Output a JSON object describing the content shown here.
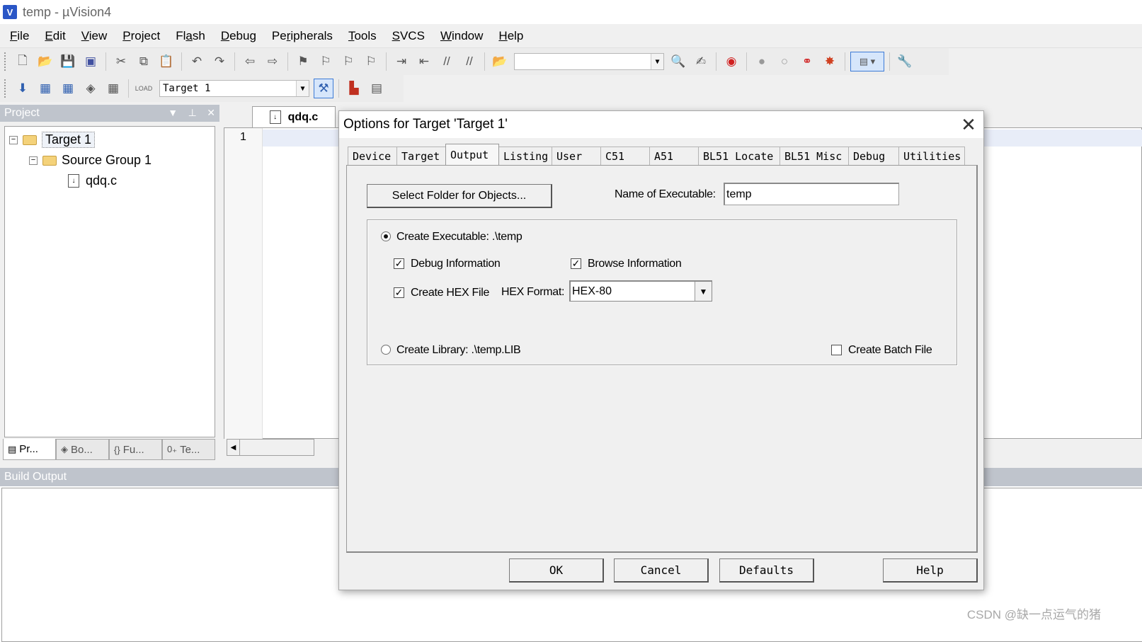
{
  "window": {
    "title": "temp  - µVision4",
    "logo": "V"
  },
  "menu": [
    {
      "pre": "",
      "u": "F",
      "post": "ile"
    },
    {
      "pre": "",
      "u": "E",
      "post": "dit"
    },
    {
      "pre": "",
      "u": "V",
      "post": "iew"
    },
    {
      "pre": "",
      "u": "P",
      "post": "roject"
    },
    {
      "pre": "Fl",
      "u": "a",
      "post": "sh"
    },
    {
      "pre": "",
      "u": "D",
      "post": "ebug"
    },
    {
      "pre": "Pe",
      "u": "r",
      "post": "ipherals"
    },
    {
      "pre": "",
      "u": "T",
      "post": "ools"
    },
    {
      "pre": "",
      "u": "S",
      "post": "VCS"
    },
    {
      "pre": "",
      "u": "W",
      "post": "indow"
    },
    {
      "pre": "",
      "u": "H",
      "post": "elp"
    }
  ],
  "toolbar2": {
    "target_combo": "Target 1",
    "load_label": "LOAD"
  },
  "project": {
    "header": "Project",
    "tree": {
      "target": "Target 1",
      "group": "Source Group 1",
      "file": "qdq.c"
    },
    "tabs": [
      "Pr...",
      "Bo...",
      "Fu...",
      "Te..."
    ],
    "tab_icons": [
      "▤",
      "◈",
      "{}",
      "0₊"
    ]
  },
  "editor": {
    "tab": "qdq.c",
    "line": "1"
  },
  "build": {
    "header": "Build Output"
  },
  "dialog": {
    "title": "Options for Target 'Target 1'",
    "close": "✕",
    "tabs": [
      "Device",
      "Target",
      "Output",
      "Listing",
      "User",
      "C51",
      "A51",
      "BL51 Locate",
      "BL51 Misc",
      "Debug",
      "Utilities"
    ],
    "active_tab": "Output",
    "select_folder_button": "Select Folder for Objects...",
    "name_exec_label": "Name of Executable:",
    "name_exec_value": "temp",
    "create_exec_label": "Create Executable:  .\\temp",
    "debug_info_label": "Debug Information",
    "browse_info_label": "Browse Information",
    "create_hex_label": "Create HEX File",
    "hex_format_label": "HEX Format:",
    "hex_format_value": "HEX-80",
    "create_lib_label": "Create Library:  .\\temp.LIB",
    "create_batch_label": "Create Batch File",
    "buttons": {
      "ok": "OK",
      "cancel": "Cancel",
      "defaults": "Defaults",
      "help": "Help"
    },
    "state": {
      "create_executable": true,
      "debug_information": true,
      "browse_information": true,
      "create_hex": true,
      "create_library": false,
      "create_batch": false
    }
  },
  "watermark": "CSDN @缺一点运气的猪"
}
